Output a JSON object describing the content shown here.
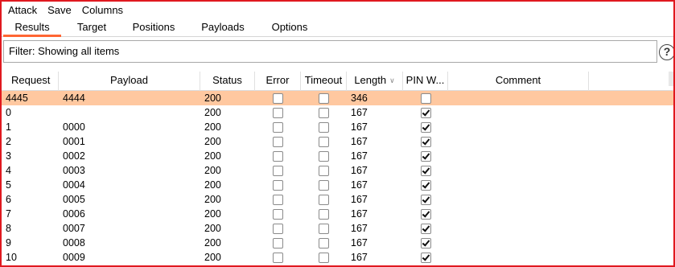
{
  "menu": [
    "Attack",
    "Save",
    "Columns"
  ],
  "tabs": [
    {
      "label": "Results",
      "active": true
    },
    {
      "label": "Target",
      "active": false
    },
    {
      "label": "Positions",
      "active": false
    },
    {
      "label": "Payloads",
      "active": false
    },
    {
      "label": "Options",
      "active": false
    }
  ],
  "filter": {
    "text": "Filter: Showing all items"
  },
  "help_icon": "question-mark-icon",
  "accent_color": "#ff6633",
  "selected_row_color": "#ffc8a0",
  "window_border_color": "#e0191f",
  "columns": [
    "Request",
    "Payload",
    "Status",
    "Error",
    "Timeout",
    "Length",
    "PIN W...",
    "Comment"
  ],
  "sorted_column": "Length",
  "rows": [
    {
      "request": "4445",
      "payload": "4444",
      "status": "200",
      "error": false,
      "timeout": false,
      "length": "346",
      "pin": false,
      "comment": "",
      "selected": true
    },
    {
      "request": "0",
      "payload": "",
      "status": "200",
      "error": false,
      "timeout": false,
      "length": "167",
      "pin": true,
      "comment": "",
      "selected": false
    },
    {
      "request": "1",
      "payload": "0000",
      "status": "200",
      "error": false,
      "timeout": false,
      "length": "167",
      "pin": true,
      "comment": "",
      "selected": false
    },
    {
      "request": "2",
      "payload": "0001",
      "status": "200",
      "error": false,
      "timeout": false,
      "length": "167",
      "pin": true,
      "comment": "",
      "selected": false
    },
    {
      "request": "3",
      "payload": "0002",
      "status": "200",
      "error": false,
      "timeout": false,
      "length": "167",
      "pin": true,
      "comment": "",
      "selected": false
    },
    {
      "request": "4",
      "payload": "0003",
      "status": "200",
      "error": false,
      "timeout": false,
      "length": "167",
      "pin": true,
      "comment": "",
      "selected": false
    },
    {
      "request": "5",
      "payload": "0004",
      "status": "200",
      "error": false,
      "timeout": false,
      "length": "167",
      "pin": true,
      "comment": "",
      "selected": false
    },
    {
      "request": "6",
      "payload": "0005",
      "status": "200",
      "error": false,
      "timeout": false,
      "length": "167",
      "pin": true,
      "comment": "",
      "selected": false
    },
    {
      "request": "7",
      "payload": "0006",
      "status": "200",
      "error": false,
      "timeout": false,
      "length": "167",
      "pin": true,
      "comment": "",
      "selected": false
    },
    {
      "request": "8",
      "payload": "0007",
      "status": "200",
      "error": false,
      "timeout": false,
      "length": "167",
      "pin": true,
      "comment": "",
      "selected": false
    },
    {
      "request": "9",
      "payload": "0008",
      "status": "200",
      "error": false,
      "timeout": false,
      "length": "167",
      "pin": true,
      "comment": "",
      "selected": false
    },
    {
      "request": "10",
      "payload": "0009",
      "status": "200",
      "error": false,
      "timeout": false,
      "length": "167",
      "pin": true,
      "comment": "",
      "selected": false
    }
  ]
}
